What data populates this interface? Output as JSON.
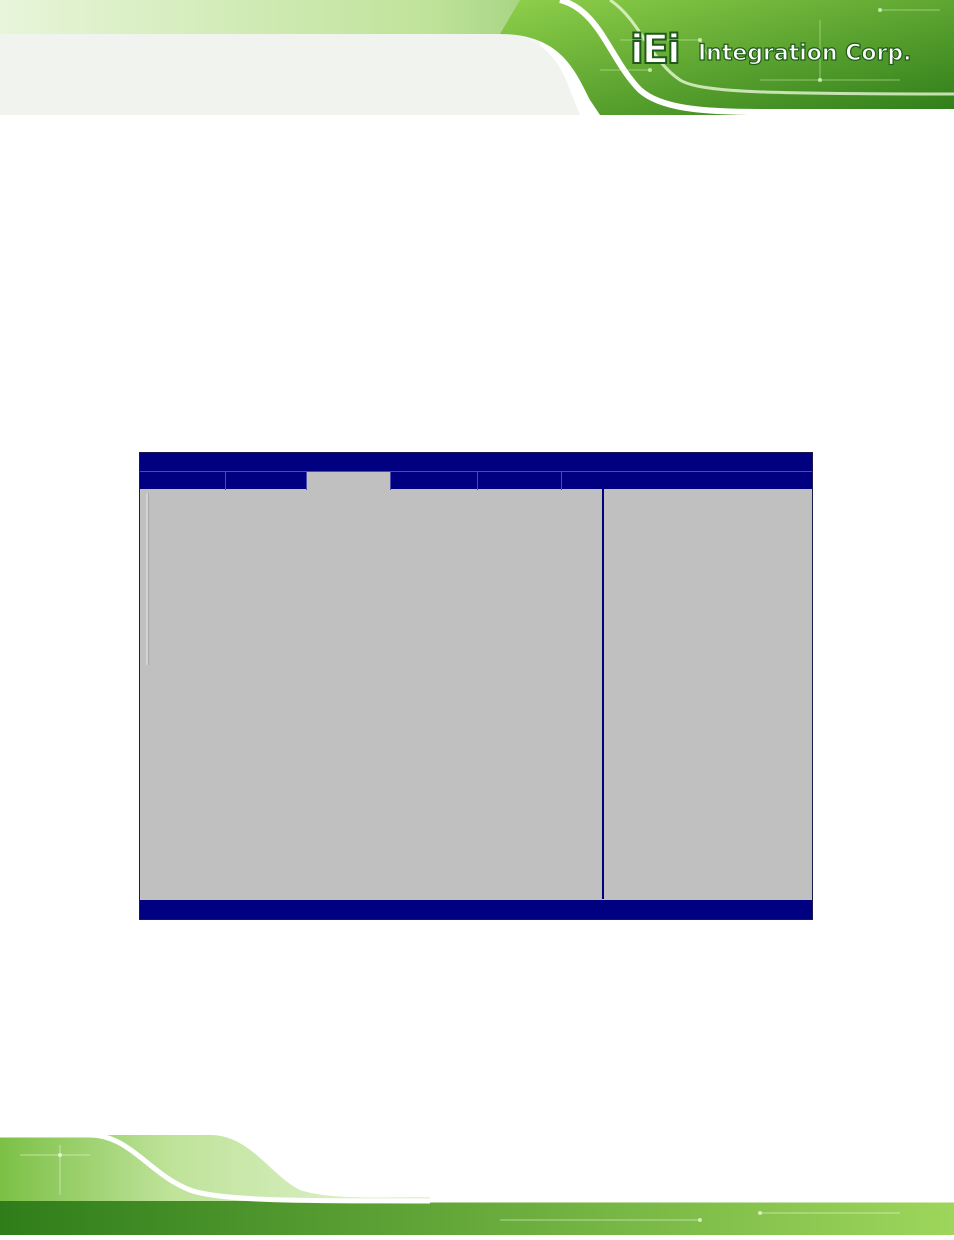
{
  "header": {
    "logo_mark": "iEi",
    "logo_text": "Integration Corp.",
    "colors": {
      "green_dark": "#2f7d1a",
      "green_light": "#8fd04a",
      "brand_outline": "#1e5a18"
    }
  },
  "bios": {
    "title": "",
    "tabs": [
      {
        "label": "",
        "active": false
      },
      {
        "label": "",
        "active": false
      },
      {
        "label": "",
        "active": true
      },
      {
        "label": "",
        "active": false
      },
      {
        "label": "",
        "active": false
      }
    ],
    "status": "",
    "colors": {
      "bar": "#000080",
      "panel": "#c0c0c0"
    }
  }
}
